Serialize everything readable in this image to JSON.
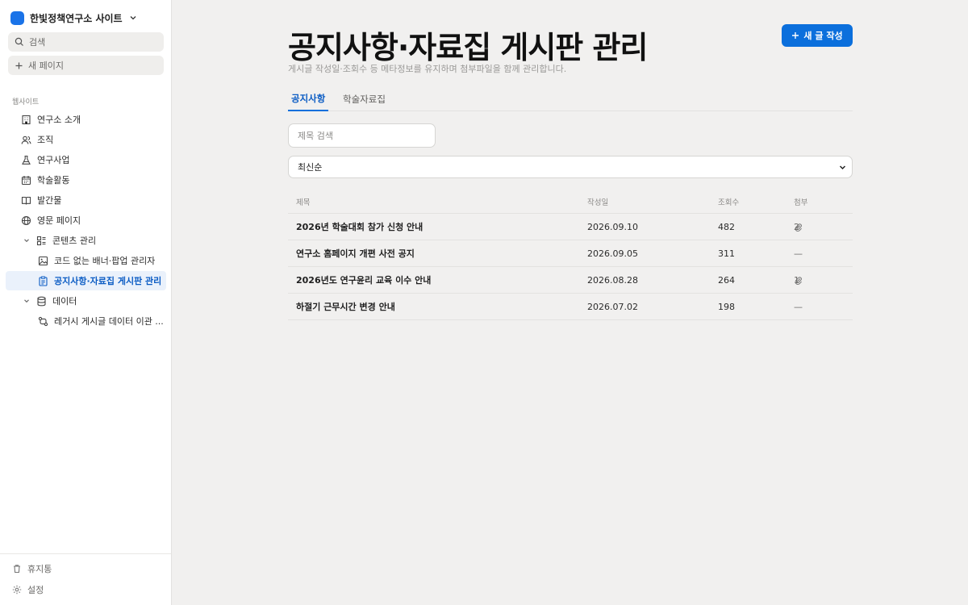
{
  "sidebar": {
    "site_name": "한빛정책연구소 사이트",
    "search_label": "검색",
    "new_page_label": "새 페이지",
    "section_label": "웹사이트",
    "items": [
      {
        "label": "연구소 소개",
        "icon": "building-icon"
      },
      {
        "label": "조직",
        "icon": "users-icon"
      },
      {
        "label": "연구사업",
        "icon": "flask-icon"
      },
      {
        "label": "학술활동",
        "icon": "calendar-icon"
      },
      {
        "label": "발간물",
        "icon": "book-icon"
      },
      {
        "label": "영문 페이지",
        "icon": "globe-icon"
      },
      {
        "label": "콘텐츠 관리",
        "icon": "grid-icon"
      },
      {
        "label": "코드 없는 배너·팝업 관리자",
        "icon": "image-icon"
      },
      {
        "label": "공지사항·자료집 게시판 관리",
        "icon": "clipboard-icon"
      },
      {
        "label": "데이터",
        "icon": "database-icon"
      },
      {
        "label": "레거시 게시글 데이터 이관 ...",
        "icon": "git-compare-icon"
      }
    ],
    "footer": {
      "trash_label": "휴지통",
      "settings_label": "설정"
    }
  },
  "main": {
    "title": "공지사항·자료집 게시판 관리",
    "subtitle": "게시글 작성일·조회수 등 메타정보를 유지하며 첨부파일을 함께 관리합니다.",
    "new_button_label": "새 글 작성",
    "tabs": [
      {
        "label": "공지사항",
        "active": true
      },
      {
        "label": "학술자료집",
        "active": false
      }
    ],
    "search_placeholder": "제목 검색",
    "sort_value": "최신순",
    "table": {
      "headers": [
        "제목",
        "작성일",
        "조회수",
        "첨부"
      ],
      "rows": [
        {
          "title": "2026년 학술대회 참가 신청 안내",
          "date": "2026.09.10",
          "views": "482",
          "attachments": "2"
        },
        {
          "title": "연구소 홈페이지 개편 사전 공지",
          "date": "2026.09.05",
          "views": "311",
          "attachments": "—"
        },
        {
          "title": "2026년도 연구윤리 교육 이수 안내",
          "date": "2026.08.28",
          "views": "264",
          "attachments": "1"
        },
        {
          "title": "하절기 근무시간 변경 안내",
          "date": "2026.07.02",
          "views": "198",
          "attachments": "—"
        }
      ]
    }
  },
  "colors": {
    "accent": "#0b6fdc",
    "active_bg": "#eaf1fb",
    "page_bg": "#f1f0ef"
  }
}
